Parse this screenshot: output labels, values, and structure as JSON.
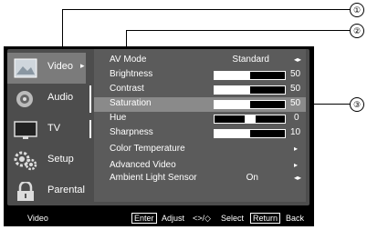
{
  "callouts": [
    "①",
    "②",
    "③"
  ],
  "sidebar": {
    "items": [
      {
        "label": "Video",
        "icon": "picture-icon",
        "selected": true,
        "arrow": "▸"
      },
      {
        "label": "Audio",
        "icon": "speaker-icon",
        "selected": false
      },
      {
        "label": "TV",
        "icon": "tv-icon",
        "selected": false
      },
      {
        "label": "Setup",
        "icon": "gears-icon",
        "selected": false
      },
      {
        "label": "Parental",
        "icon": "lock-icon",
        "selected": false
      }
    ]
  },
  "menu": {
    "rows": [
      {
        "name": "AV Mode",
        "value": "Standard",
        "glyph": "◂▸"
      },
      {
        "name": "Brightness",
        "level": 0.5,
        "number": "50"
      },
      {
        "name": "Contrast",
        "level": 0.5,
        "number": "50"
      },
      {
        "name": "Saturation",
        "level": 0.5,
        "number": "50",
        "highlighted": true
      },
      {
        "name": "Hue",
        "level": 0.5,
        "number": "0",
        "centered": true
      },
      {
        "name": "Sharpness",
        "level": 0.5,
        "number": "10"
      },
      {
        "name": "Color Temperature",
        "glyph": "▸"
      },
      {
        "name": "Advanced Video",
        "glyph": "▸"
      },
      {
        "name": "Ambient Light Sensor",
        "value": "On",
        "glyph": "◂▸"
      }
    ]
  },
  "footer": {
    "section": "Video",
    "enter_key": "Enter",
    "adjust": "Adjust",
    "nav_keys": "<>/◇",
    "select": "Select",
    "return_key": "Return",
    "back": "Back"
  }
}
